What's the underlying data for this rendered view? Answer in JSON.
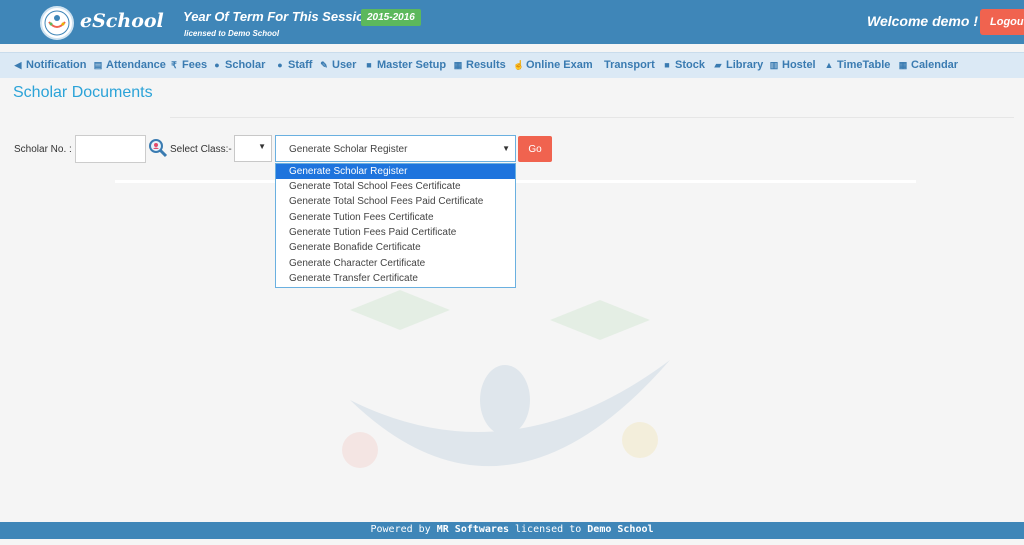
{
  "header": {
    "brand": "eSchool",
    "term_title": "Year Of Term For This Session :-",
    "session": "2015-2016",
    "licensed": "licensed to Demo School",
    "welcome": "Welcome demo !",
    "logout": "Logout"
  },
  "nav": {
    "items": [
      {
        "label": "Notification",
        "icon": "bullhorn-icon"
      },
      {
        "label": "Attendance",
        "icon": "document-icon"
      },
      {
        "label": "Fees",
        "icon": "rupee-icon"
      },
      {
        "label": "Scholar",
        "icon": "users-icon"
      },
      {
        "label": "Staff",
        "icon": "user-icon"
      },
      {
        "label": "User",
        "icon": "wrench-icon"
      },
      {
        "label": "Master Setup",
        "icon": "unlock-icon"
      },
      {
        "label": "Results",
        "icon": "chart-icon"
      },
      {
        "label": "Online Exam",
        "icon": "thumbs-up-icon"
      },
      {
        "label": "Transport",
        "icon": ""
      },
      {
        "label": "Stock",
        "icon": "folder-icon"
      },
      {
        "label": "Library",
        "icon": "book-icon"
      },
      {
        "label": "Hostel",
        "icon": "building-icon"
      },
      {
        "label": "TimeTable",
        "icon": "bell-icon"
      },
      {
        "label": "Calendar",
        "icon": "calendar-icon"
      }
    ]
  },
  "page": {
    "title": "Scholar Documents",
    "scholar_no_label": "Scholar No. :",
    "scholar_no_value": "",
    "select_class_label": "Select Class:-",
    "select_class_value": "",
    "document_selected": "Generate Scholar Register",
    "go_label": "Go",
    "document_options": [
      "Generate Scholar Register",
      "Generate Total School Fees Certificate",
      "Generate Total School Fees Paid Certificate",
      "Generate Tution Fees Certificate",
      "Generate Tution Fees Paid Certificate",
      "Generate Bonafide Certificate",
      "Generate Character Certificate",
      "Generate Transfer Certificate"
    ]
  },
  "footer": {
    "powered_by": "Powered by",
    "company": "MR Softwares",
    "licensed_to": "licensed to",
    "school": "Demo School"
  },
  "colors": {
    "header": "#3f86b8",
    "nav_bg": "#dbe9f5",
    "accent": "#2ba3d8",
    "go_button": "#f0634f",
    "badge": "#5cb85c",
    "selected_option": "#1e74dd"
  }
}
